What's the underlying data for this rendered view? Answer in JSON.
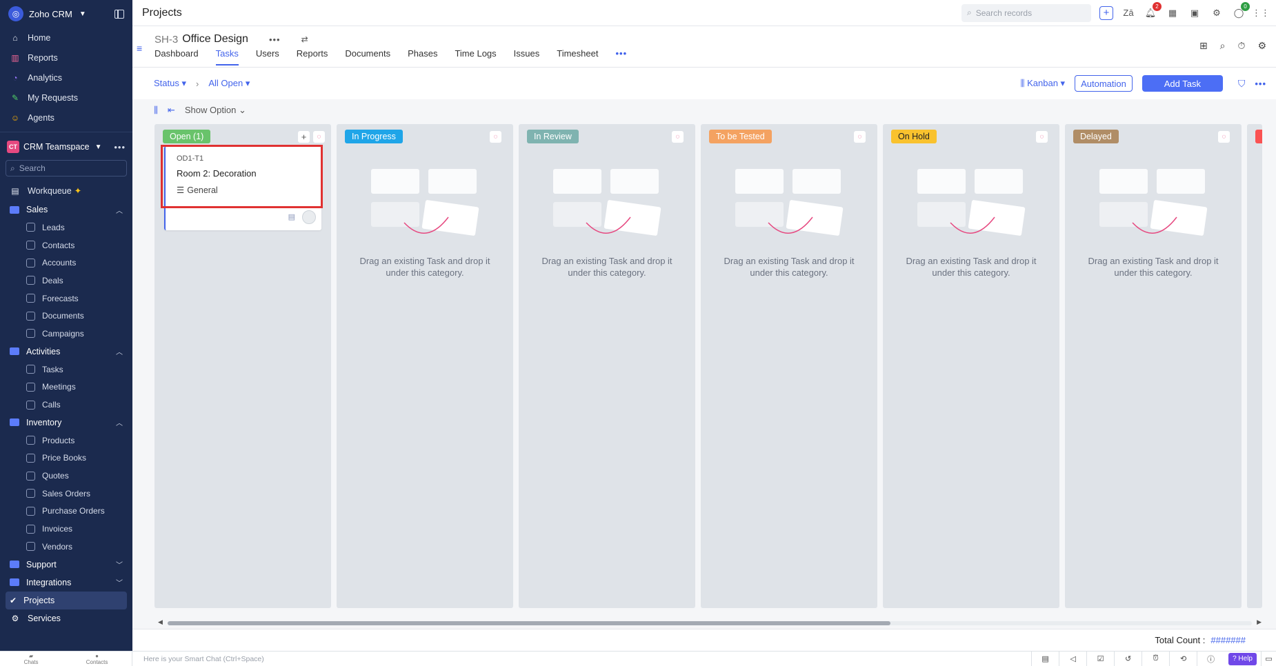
{
  "app": {
    "name": "Zoho CRM"
  },
  "sidebar": {
    "top_items": [
      {
        "label": "Home"
      },
      {
        "label": "Reports"
      },
      {
        "label": "Analytics"
      },
      {
        "label": "My Requests"
      },
      {
        "label": "Agents"
      }
    ],
    "team": {
      "badge": "CT",
      "name": "CRM Teamspace"
    },
    "search_placeholder": "Search",
    "workqueue": "Workqueue",
    "groups": {
      "sales": {
        "label": "Sales",
        "items": [
          "Leads",
          "Contacts",
          "Accounts",
          "Deals",
          "Forecasts",
          "Documents",
          "Campaigns"
        ]
      },
      "activities": {
        "label": "Activities",
        "items": [
          "Tasks",
          "Meetings",
          "Calls"
        ]
      },
      "inventory": {
        "label": "Inventory",
        "items": [
          "Products",
          "Price Books",
          "Quotes",
          "Sales Orders",
          "Purchase Orders",
          "Invoices",
          "Vendors"
        ]
      },
      "support": {
        "label": "Support"
      },
      "integrations": {
        "label": "Integrations"
      }
    },
    "projects": "Projects",
    "services": "Services"
  },
  "topbar": {
    "title": "Projects",
    "search_placeholder": "Search records",
    "notif_count": "2",
    "avatar_count": "0"
  },
  "project": {
    "code": "SH-3",
    "name": "Office Design",
    "tabs": [
      "Dashboard",
      "Tasks",
      "Users",
      "Reports",
      "Documents",
      "Phases",
      "Time Logs",
      "Issues",
      "Timesheet"
    ],
    "active_tab": "Tasks"
  },
  "filters": {
    "status": "Status",
    "view": "All Open",
    "layout": "Kanban",
    "automation": "Automation",
    "add_task": "Add Task"
  },
  "board": {
    "show_option": "Show Option",
    "empty_text": "Drag an existing Task and drop it under this category.",
    "columns": [
      {
        "label": "Open (1)",
        "color": "#69c36b"
      },
      {
        "label": "In Progress",
        "color": "#1fa5e8"
      },
      {
        "label": "In Review",
        "color": "#7fb3b0"
      },
      {
        "label": "To be Tested",
        "color": "#f4a261"
      },
      {
        "label": "On Hold",
        "color": "#f9c22e"
      },
      {
        "label": "Delayed",
        "color": "#b08d66"
      }
    ],
    "card": {
      "id": "OD1-T1",
      "title": "Room 2: Decoration",
      "tag": "General"
    }
  },
  "footer": {
    "total_label": "Total Count :",
    "total_value": "#######",
    "chat_placeholder": "Here is your Smart Chat (Ctrl+Space)",
    "chats": "Chats",
    "contacts": "Contacts",
    "help": "Help"
  },
  "colors": {
    "sidebar_bg": "#1b2a4e",
    "accent": "#4263eb",
    "highlight": "#e03131"
  }
}
